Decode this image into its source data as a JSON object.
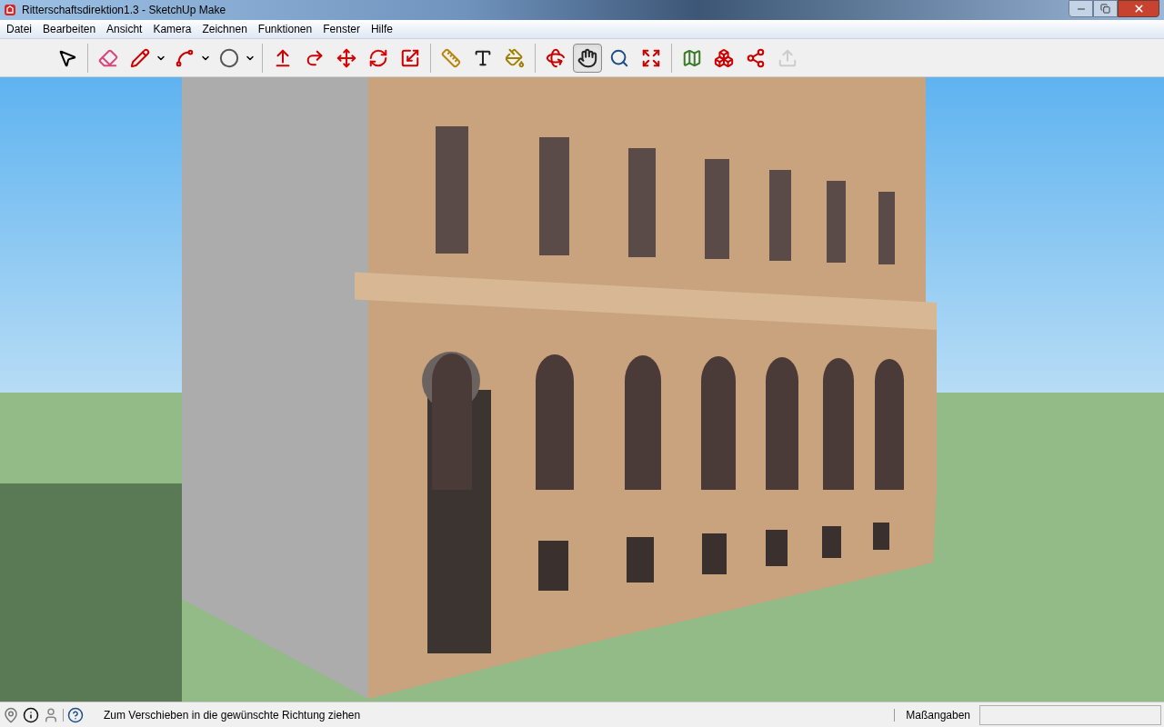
{
  "window": {
    "title": "Ritterschaftsdirektion1.3 - SketchUp Make"
  },
  "menu": [
    "Datei",
    "Bearbeiten",
    "Ansicht",
    "Kamera",
    "Zeichnen",
    "Funktionen",
    "Fenster",
    "Hilfe"
  ],
  "toolbar": {
    "groups": [
      [
        {
          "kind": "select",
          "selected": false,
          "disabled": false,
          "dropdown": false
        }
      ],
      [
        {
          "kind": "eraser",
          "selected": false,
          "disabled": false,
          "dropdown": false
        },
        {
          "kind": "pencil",
          "selected": false,
          "disabled": false,
          "dropdown": true
        },
        {
          "kind": "arc",
          "selected": false,
          "disabled": false,
          "dropdown": true
        },
        {
          "kind": "circle",
          "selected": false,
          "disabled": false,
          "dropdown": true
        }
      ],
      [
        {
          "kind": "pushpull",
          "selected": false,
          "disabled": false,
          "dropdown": false
        },
        {
          "kind": "followme",
          "selected": false,
          "disabled": false,
          "dropdown": false
        },
        {
          "kind": "move",
          "selected": false,
          "disabled": false,
          "dropdown": false
        },
        {
          "kind": "rotate",
          "selected": false,
          "disabled": false,
          "dropdown": false
        },
        {
          "kind": "scale",
          "selected": false,
          "disabled": false,
          "dropdown": false
        }
      ],
      [
        {
          "kind": "tape",
          "selected": false,
          "disabled": false,
          "dropdown": false
        },
        {
          "kind": "text",
          "selected": false,
          "disabled": false,
          "dropdown": false
        },
        {
          "kind": "paint",
          "selected": false,
          "disabled": false,
          "dropdown": false
        }
      ],
      [
        {
          "kind": "orbit",
          "selected": false,
          "disabled": false,
          "dropdown": false
        },
        {
          "kind": "pan",
          "selected": true,
          "disabled": false,
          "dropdown": false
        },
        {
          "kind": "zoom",
          "selected": false,
          "disabled": false,
          "dropdown": false
        },
        {
          "kind": "zoomextents",
          "selected": false,
          "disabled": false,
          "dropdown": false
        }
      ],
      [
        {
          "kind": "map",
          "selected": false,
          "disabled": false,
          "dropdown": false
        },
        {
          "kind": "warehouse",
          "selected": false,
          "disabled": false,
          "dropdown": false
        },
        {
          "kind": "share",
          "selected": false,
          "disabled": false,
          "dropdown": false
        },
        {
          "kind": "upload",
          "selected": false,
          "disabled": true,
          "dropdown": false
        }
      ]
    ]
  },
  "status_bar": {
    "message": "Zum Verschieben in die gewünschte Richtung ziehen",
    "measurements_label": "Maßangaben"
  }
}
